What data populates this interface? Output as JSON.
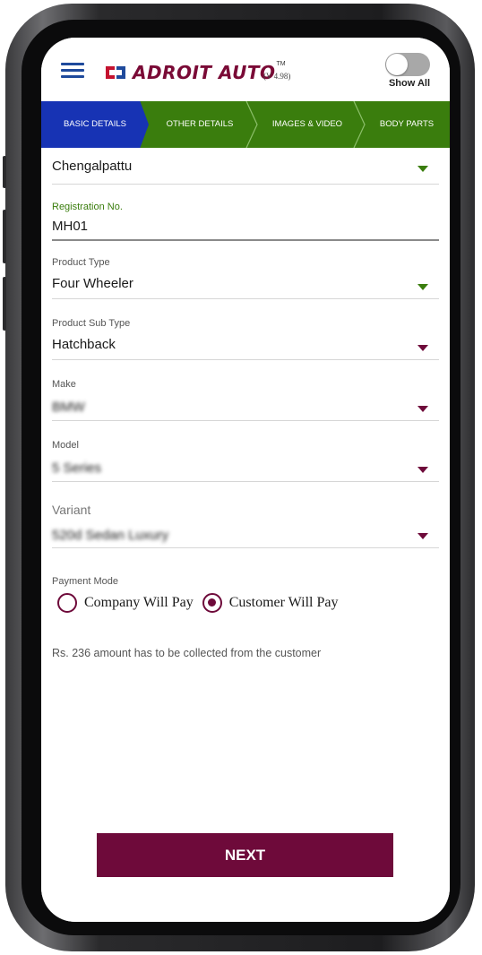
{
  "header": {
    "brand": "ADROIT AUTO",
    "trademark": "TM",
    "version": "(V 4.98)",
    "toggle_label": "Show All"
  },
  "steps": [
    {
      "label": "BASIC DETAILS"
    },
    {
      "label": "OTHER DETAILS"
    },
    {
      "label": "IMAGES & VIDEO"
    },
    {
      "label": "BODY PARTS"
    }
  ],
  "form": {
    "location": {
      "value": "Chengalpattu"
    },
    "registration": {
      "label": "Registration No.",
      "value": "MH01"
    },
    "product_type": {
      "label": "Product Type",
      "value": "Four Wheeler"
    },
    "product_sub_type": {
      "label": "Product Sub Type",
      "value": "Hatchback"
    },
    "make": {
      "label": "Make",
      "value": "BMW"
    },
    "model": {
      "label": "Model",
      "value": "5 Series"
    },
    "variant": {
      "label": "Variant",
      "value": "520d Sedan Luxury"
    },
    "payment_mode": {
      "label": "Payment Mode",
      "options": [
        "Company Will Pay",
        "Customer Will Pay"
      ],
      "selected": "Customer Will Pay"
    },
    "note": "Rs. 236 amount has to be collected from the customer"
  },
  "actions": {
    "next_label": "NEXT"
  },
  "colors": {
    "primary": "#6e0a3a",
    "step_active": "#1733b4",
    "step_bg": "#3a7d0d",
    "menu": "#1f4a9c"
  }
}
